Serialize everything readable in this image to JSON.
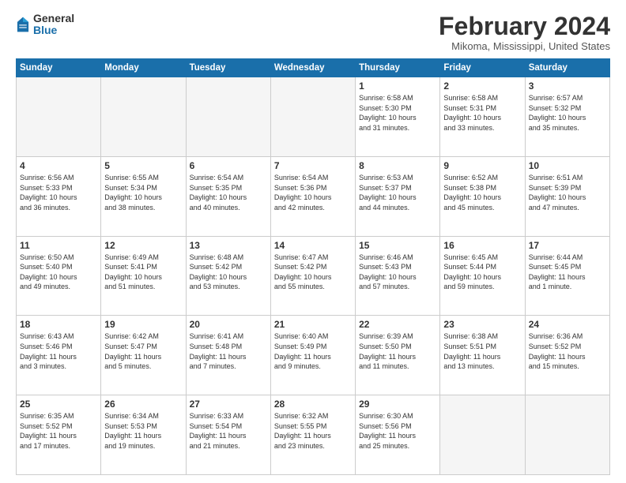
{
  "header": {
    "logo_general": "General",
    "logo_blue": "Blue",
    "month_title": "February 2024",
    "location": "Mikoma, Mississippi, United States"
  },
  "days_of_week": [
    "Sunday",
    "Monday",
    "Tuesday",
    "Wednesday",
    "Thursday",
    "Friday",
    "Saturday"
  ],
  "weeks": [
    [
      {
        "day": "",
        "info": ""
      },
      {
        "day": "",
        "info": ""
      },
      {
        "day": "",
        "info": ""
      },
      {
        "day": "",
        "info": ""
      },
      {
        "day": "1",
        "info": "Sunrise: 6:58 AM\nSunset: 5:30 PM\nDaylight: 10 hours\nand 31 minutes."
      },
      {
        "day": "2",
        "info": "Sunrise: 6:58 AM\nSunset: 5:31 PM\nDaylight: 10 hours\nand 33 minutes."
      },
      {
        "day": "3",
        "info": "Sunrise: 6:57 AM\nSunset: 5:32 PM\nDaylight: 10 hours\nand 35 minutes."
      }
    ],
    [
      {
        "day": "4",
        "info": "Sunrise: 6:56 AM\nSunset: 5:33 PM\nDaylight: 10 hours\nand 36 minutes."
      },
      {
        "day": "5",
        "info": "Sunrise: 6:55 AM\nSunset: 5:34 PM\nDaylight: 10 hours\nand 38 minutes."
      },
      {
        "day": "6",
        "info": "Sunrise: 6:54 AM\nSunset: 5:35 PM\nDaylight: 10 hours\nand 40 minutes."
      },
      {
        "day": "7",
        "info": "Sunrise: 6:54 AM\nSunset: 5:36 PM\nDaylight: 10 hours\nand 42 minutes."
      },
      {
        "day": "8",
        "info": "Sunrise: 6:53 AM\nSunset: 5:37 PM\nDaylight: 10 hours\nand 44 minutes."
      },
      {
        "day": "9",
        "info": "Sunrise: 6:52 AM\nSunset: 5:38 PM\nDaylight: 10 hours\nand 45 minutes."
      },
      {
        "day": "10",
        "info": "Sunrise: 6:51 AM\nSunset: 5:39 PM\nDaylight: 10 hours\nand 47 minutes."
      }
    ],
    [
      {
        "day": "11",
        "info": "Sunrise: 6:50 AM\nSunset: 5:40 PM\nDaylight: 10 hours\nand 49 minutes."
      },
      {
        "day": "12",
        "info": "Sunrise: 6:49 AM\nSunset: 5:41 PM\nDaylight: 10 hours\nand 51 minutes."
      },
      {
        "day": "13",
        "info": "Sunrise: 6:48 AM\nSunset: 5:42 PM\nDaylight: 10 hours\nand 53 minutes."
      },
      {
        "day": "14",
        "info": "Sunrise: 6:47 AM\nSunset: 5:42 PM\nDaylight: 10 hours\nand 55 minutes."
      },
      {
        "day": "15",
        "info": "Sunrise: 6:46 AM\nSunset: 5:43 PM\nDaylight: 10 hours\nand 57 minutes."
      },
      {
        "day": "16",
        "info": "Sunrise: 6:45 AM\nSunset: 5:44 PM\nDaylight: 10 hours\nand 59 minutes."
      },
      {
        "day": "17",
        "info": "Sunrise: 6:44 AM\nSunset: 5:45 PM\nDaylight: 11 hours\nand 1 minute."
      }
    ],
    [
      {
        "day": "18",
        "info": "Sunrise: 6:43 AM\nSunset: 5:46 PM\nDaylight: 11 hours\nand 3 minutes."
      },
      {
        "day": "19",
        "info": "Sunrise: 6:42 AM\nSunset: 5:47 PM\nDaylight: 11 hours\nand 5 minutes."
      },
      {
        "day": "20",
        "info": "Sunrise: 6:41 AM\nSunset: 5:48 PM\nDaylight: 11 hours\nand 7 minutes."
      },
      {
        "day": "21",
        "info": "Sunrise: 6:40 AM\nSunset: 5:49 PM\nDaylight: 11 hours\nand 9 minutes."
      },
      {
        "day": "22",
        "info": "Sunrise: 6:39 AM\nSunset: 5:50 PM\nDaylight: 11 hours\nand 11 minutes."
      },
      {
        "day": "23",
        "info": "Sunrise: 6:38 AM\nSunset: 5:51 PM\nDaylight: 11 hours\nand 13 minutes."
      },
      {
        "day": "24",
        "info": "Sunrise: 6:36 AM\nSunset: 5:52 PM\nDaylight: 11 hours\nand 15 minutes."
      }
    ],
    [
      {
        "day": "25",
        "info": "Sunrise: 6:35 AM\nSunset: 5:52 PM\nDaylight: 11 hours\nand 17 minutes."
      },
      {
        "day": "26",
        "info": "Sunrise: 6:34 AM\nSunset: 5:53 PM\nDaylight: 11 hours\nand 19 minutes."
      },
      {
        "day": "27",
        "info": "Sunrise: 6:33 AM\nSunset: 5:54 PM\nDaylight: 11 hours\nand 21 minutes."
      },
      {
        "day": "28",
        "info": "Sunrise: 6:32 AM\nSunset: 5:55 PM\nDaylight: 11 hours\nand 23 minutes."
      },
      {
        "day": "29",
        "info": "Sunrise: 6:30 AM\nSunset: 5:56 PM\nDaylight: 11 hours\nand 25 minutes."
      },
      {
        "day": "",
        "info": ""
      },
      {
        "day": "",
        "info": ""
      }
    ]
  ]
}
